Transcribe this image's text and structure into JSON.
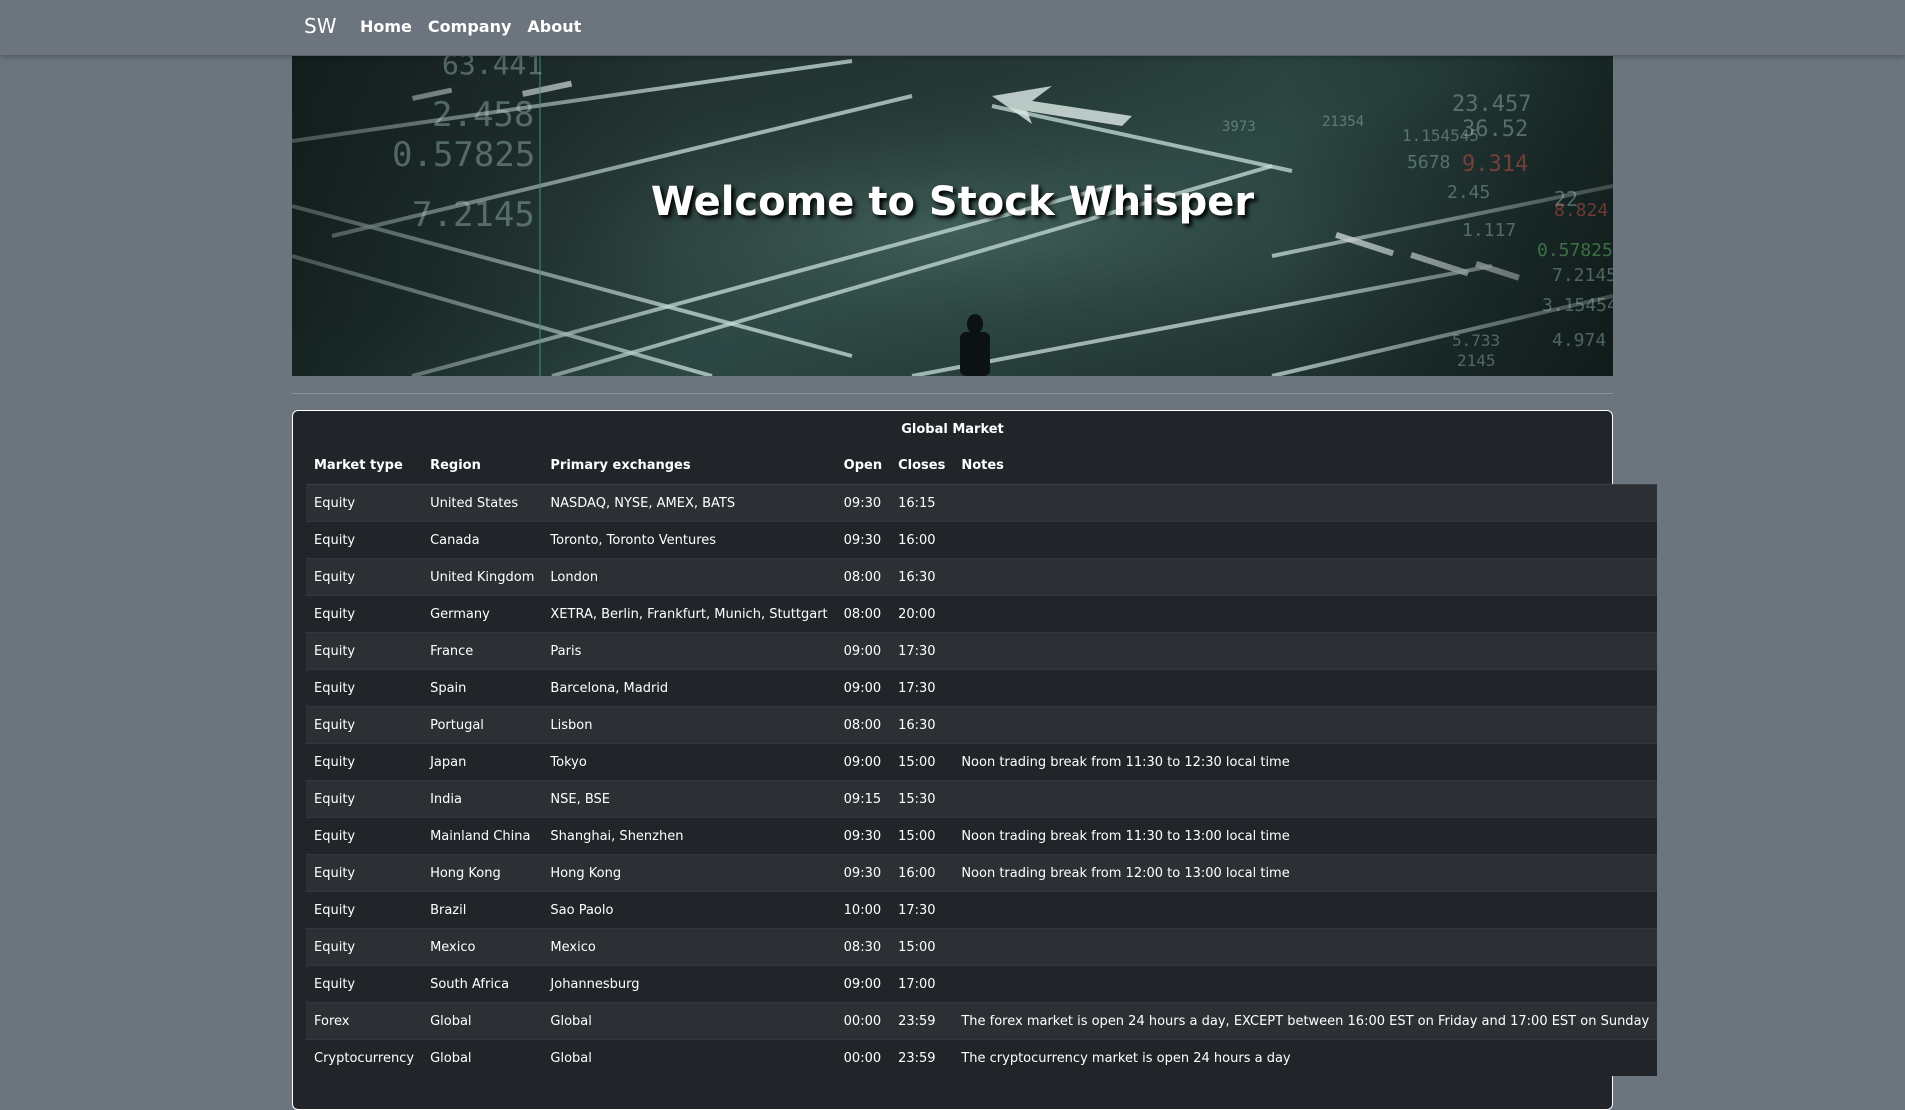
{
  "navbar": {
    "brand": "SW",
    "links": [
      "Home",
      "Company",
      "About"
    ]
  },
  "hero": {
    "title": "Welcome to Stock Whisper",
    "background_numbers": [
      "63.441",
      "2.458",
      "0.57825",
      "7.2145",
      "23.457",
      "36.52",
      "1.154545",
      "5678",
      "9.314",
      "2.45",
      "22",
      "1.117",
      "8.824",
      "0.57825",
      "7.2145",
      "3.15454",
      "4.974",
      "5.733",
      "3973",
      "2145",
      "21354"
    ]
  },
  "table": {
    "caption": "Global Market",
    "columns": [
      "Market type",
      "Region",
      "Primary exchanges",
      "Open",
      "Closes",
      "Notes"
    ],
    "rows": [
      [
        "Equity",
        "United States",
        "NASDAQ, NYSE, AMEX, BATS",
        "09:30",
        "16:15",
        ""
      ],
      [
        "Equity",
        "Canada",
        "Toronto, Toronto Ventures",
        "09:30",
        "16:00",
        ""
      ],
      [
        "Equity",
        "United Kingdom",
        "London",
        "08:00",
        "16:30",
        ""
      ],
      [
        "Equity",
        "Germany",
        "XETRA, Berlin, Frankfurt, Munich, Stuttgart",
        "08:00",
        "20:00",
        ""
      ],
      [
        "Equity",
        "France",
        "Paris",
        "09:00",
        "17:30",
        ""
      ],
      [
        "Equity",
        "Spain",
        "Barcelona, Madrid",
        "09:00",
        "17:30",
        ""
      ],
      [
        "Equity",
        "Portugal",
        "Lisbon",
        "08:00",
        "16:30",
        ""
      ],
      [
        "Equity",
        "Japan",
        "Tokyo",
        "09:00",
        "15:00",
        "Noon trading break from 11:30 to 12:30 local time"
      ],
      [
        "Equity",
        "India",
        "NSE, BSE",
        "09:15",
        "15:30",
        ""
      ],
      [
        "Equity",
        "Mainland China",
        "Shanghai, Shenzhen",
        "09:30",
        "15:00",
        "Noon trading break from 11:30 to 13:00 local time"
      ],
      [
        "Equity",
        "Hong Kong",
        "Hong Kong",
        "09:30",
        "16:00",
        "Noon trading break from 12:00 to 13:00 local time"
      ],
      [
        "Equity",
        "Brazil",
        "Sao Paolo",
        "10:00",
        "17:30",
        ""
      ],
      [
        "Equity",
        "Mexico",
        "Mexico",
        "08:30",
        "15:00",
        ""
      ],
      [
        "Equity",
        "South Africa",
        "Johannesburg",
        "09:00",
        "17:00",
        ""
      ],
      [
        "Forex",
        "Global",
        "Global",
        "00:00",
        "23:59",
        "The forex market is open 24 hours a day, EXCEPT between 16:00 EST on Friday and 17:00 EST on Sunday"
      ],
      [
        "Cryptocurrency",
        "Global",
        "Global",
        "00:00",
        "23:59",
        "The cryptocurrency market is open 24 hours a day"
      ]
    ]
  }
}
